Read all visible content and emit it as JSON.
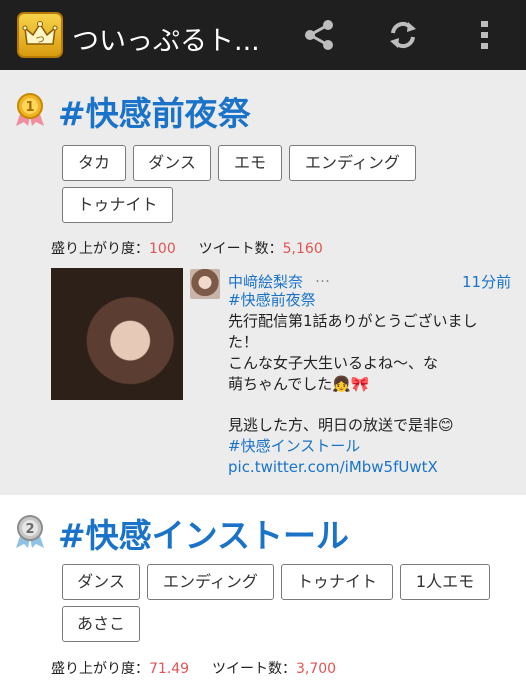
{
  "app": {
    "title": "ついっぷるト...",
    "icon": "crown-icon",
    "actions": [
      "share-icon",
      "refresh-icon",
      "more-vert-icon"
    ]
  },
  "topics": [
    {
      "rank_icon": "gold-medal-1-icon",
      "title": "#快感前夜祭",
      "tags": [
        "タカ",
        "ダンス",
        "エモ",
        "エンディング",
        "トゥナイト"
      ],
      "stats": {
        "excitement_label": "盛り上がり度：",
        "excitement_value": "100",
        "tweets_label": "ツイート数：",
        "tweets_value": "5,160"
      },
      "tweet": {
        "user": "中﨑絵梨奈",
        "menu": "…",
        "time": "11分前",
        "hashtag": "#快感前夜祭",
        "line1": "先行配信第1話ありがとうございまし",
        "line2": "た！",
        "line3": "こんな女子大生いるよね〜、な",
        "line4": "萌ちゃんでした👧🎀",
        "line5": "見逃した方、明日の放送で是非😊",
        "link_hashtag": "#快感インストール",
        "link_url": "pic.twitter.com/iMbw5fUwtX"
      }
    },
    {
      "rank_icon": "silver-medal-2-icon",
      "title": "#快感インストール",
      "tags": [
        "ダンス",
        "エンディング",
        "トゥナイト",
        "1人エモ",
        "あさこ"
      ],
      "stats": {
        "excitement_label": "盛り上がり度：",
        "excitement_value": "71.49",
        "tweets_label": "ツイート数：",
        "tweets_value": "3,700"
      }
    }
  ],
  "colors": {
    "appbar": "#1f1f1f",
    "accent_blue": "#1a73c9",
    "stat_red": "#e05555"
  }
}
